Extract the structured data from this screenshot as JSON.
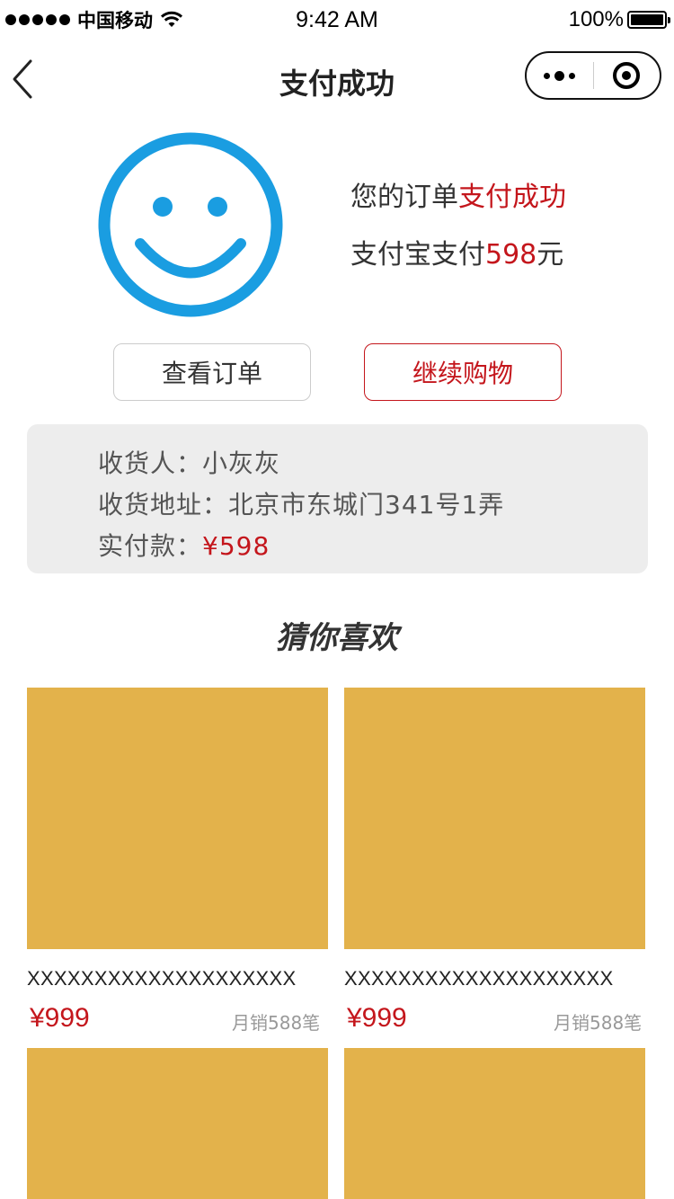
{
  "status_bar": {
    "carrier": "中国移动",
    "time": "9:42 AM",
    "battery": "100%"
  },
  "nav": {
    "title": "支付成功"
  },
  "success": {
    "line1_prefix": "您的订单",
    "line1_highlight": "支付成功",
    "line2_prefix": "支付宝支付",
    "line2_amount": "598",
    "line2_suffix": "元"
  },
  "actions": {
    "view_order": "查看订单",
    "continue_shopping": "继续购物"
  },
  "order_info": {
    "receiver_label": "收货人：",
    "receiver": "小灰灰",
    "address_label": "收货地址：",
    "address": "北京市东城门341号1弄",
    "paid_label": "实付款：",
    "paid": "¥598"
  },
  "recommend": {
    "title": "猜你喜欢",
    "products": [
      {
        "name": "XXXXXXXXXXXXXXXXXXXX",
        "price": "¥999",
        "sales": "月销588笔"
      },
      {
        "name": "XXXXXXXXXXXXXXXXXXXX",
        "price": "¥999",
        "sales": "月销588笔"
      },
      {
        "name": "",
        "price": "",
        "sales": ""
      },
      {
        "name": "",
        "price": "",
        "sales": ""
      }
    ]
  },
  "colors": {
    "accent": "#c4161c",
    "smiley": "#1a9de1",
    "placeholder": "#e3b24b",
    "card_bg": "#ededed"
  }
}
